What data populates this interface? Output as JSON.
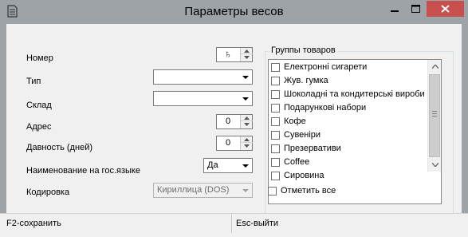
{
  "window": {
    "title": "Параметры весов"
  },
  "form": {
    "number": {
      "label": "Номер",
      "value": "♄"
    },
    "type": {
      "label": "Тип",
      "value": ""
    },
    "warehouse": {
      "label": "Склад",
      "value": ""
    },
    "address": {
      "label": "Адрес",
      "value": "0"
    },
    "age": {
      "label": "Давность (дней)",
      "value": "0"
    },
    "state_lang_name": {
      "label": "Наименование на гос.языке",
      "value": "Да"
    },
    "encoding": {
      "label": "Кодировка",
      "value": "Кириллица (DOS)"
    }
  },
  "groups": {
    "title": "Группы товаров",
    "items": [
      "Електронні сигарети",
      "Жув. гумка",
      "Шоколадні та кондитерські вироби",
      "Подарункові набори",
      "Кофе",
      "Сувеніри",
      "Презервативи",
      "Coffee",
      "Сировина"
    ],
    "check_all_label": "Отметить все"
  },
  "status": {
    "save": "F2-сохранить",
    "exit": "Esc-выйти"
  }
}
